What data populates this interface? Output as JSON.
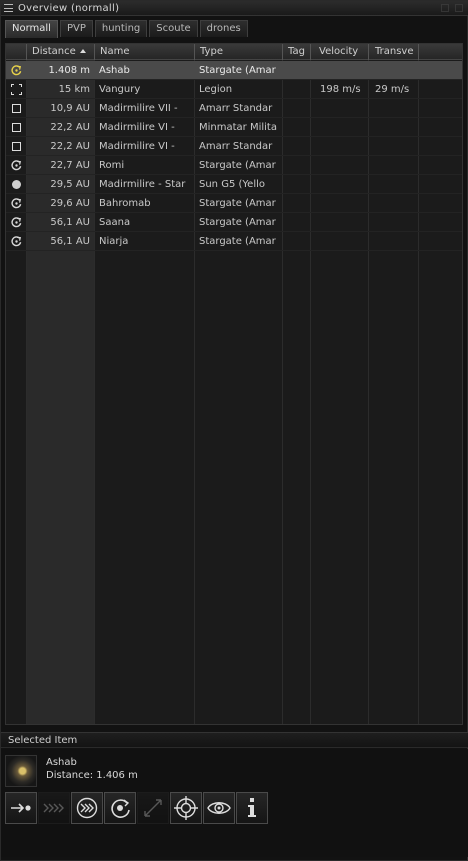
{
  "window": {
    "title": "Overview (normall)"
  },
  "tabs": [
    {
      "label": "Normall",
      "active": true
    },
    {
      "label": "PVP",
      "active": false
    },
    {
      "label": "hunting",
      "active": false
    },
    {
      "label": "Scoute",
      "active": false
    },
    {
      "label": "drones",
      "active": false
    }
  ],
  "columns": {
    "distance": "Distance",
    "name": "Name",
    "type": "Type",
    "tag": "Tag",
    "velocity": "Velocity",
    "transversal": "Transve"
  },
  "sort": {
    "column": "distance",
    "direction": "ascending"
  },
  "rows": [
    {
      "icon": "stargate-icon",
      "distance": "1.408 m",
      "name": "Ashab",
      "type": "Stargate (Amar",
      "tag": "",
      "velocity": "",
      "transversal": "",
      "selected": true
    },
    {
      "icon": "ship-bracket-icon",
      "distance": "15 km",
      "name": "Vangury",
      "type": "Legion",
      "tag": "",
      "velocity": "198 m/s",
      "transversal": "29 m/s",
      "selected": false
    },
    {
      "icon": "planet-square-icon",
      "distance": "10,9 AU",
      "name": "Madirmilire VII -",
      "type": "Amarr Standar",
      "tag": "",
      "velocity": "",
      "transversal": "",
      "selected": false
    },
    {
      "icon": "planet-square-icon",
      "distance": "22,2 AU",
      "name": "Madirmilire VI -",
      "type": "Minmatar Milita",
      "tag": "",
      "velocity": "",
      "transversal": "",
      "selected": false
    },
    {
      "icon": "planet-square-icon",
      "distance": "22,2 AU",
      "name": "Madirmilire VI -",
      "type": "Amarr Standar",
      "tag": "",
      "velocity": "",
      "transversal": "",
      "selected": false
    },
    {
      "icon": "stargate-icon",
      "distance": "22,7 AU",
      "name": "Romi",
      "type": "Stargate (Amar",
      "tag": "",
      "velocity": "",
      "transversal": "",
      "selected": false
    },
    {
      "icon": "sun-icon",
      "distance": "29,5 AU",
      "name": "Madirmilire - Star",
      "type": "Sun G5 (Yello",
      "tag": "",
      "velocity": "",
      "transversal": "",
      "selected": false
    },
    {
      "icon": "stargate-icon",
      "distance": "29,6 AU",
      "name": "Bahromab",
      "type": "Stargate (Amar",
      "tag": "",
      "velocity": "",
      "transversal": "",
      "selected": false
    },
    {
      "icon": "stargate-icon",
      "distance": "56,1 AU",
      "name": "Saana",
      "type": "Stargate (Amar",
      "tag": "",
      "velocity": "",
      "transversal": "",
      "selected": false
    },
    {
      "icon": "stargate-icon",
      "distance": "56,1 AU",
      "name": "Niarja",
      "type": "Stargate (Amar",
      "tag": "",
      "velocity": "",
      "transversal": "",
      "selected": false
    }
  ],
  "selected_item": {
    "header": "Selected Item",
    "name": "Ashab",
    "distance": "Distance: 1.406 m",
    "actions": [
      {
        "icon": "approach-icon",
        "enabled": true
      },
      {
        "icon": "warp-to-icon",
        "enabled": false
      },
      {
        "icon": "jump-icon",
        "enabled": true
      },
      {
        "icon": "orbit-icon",
        "enabled": true
      },
      {
        "icon": "keep-at-range-icon",
        "enabled": false
      },
      {
        "icon": "lock-target-icon",
        "enabled": true
      },
      {
        "icon": "look-at-icon",
        "enabled": true
      },
      {
        "icon": "show-info-icon",
        "enabled": true
      }
    ]
  },
  "colors": {
    "selected_row": "#4a4a4a",
    "stargate_selected_icon": "#e8d24a",
    "text": "#c9c9c9"
  }
}
